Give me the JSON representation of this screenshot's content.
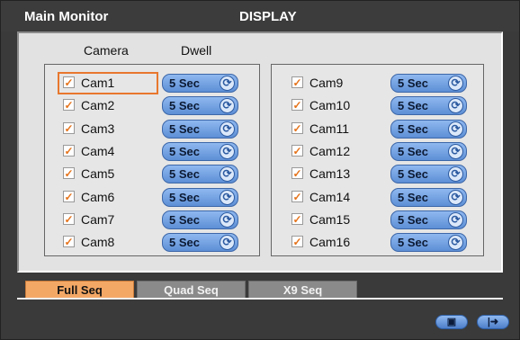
{
  "header": {
    "left_title": "Main Monitor",
    "center_title": "DISPLAY"
  },
  "columns": {
    "camera": "Camera",
    "dwell": "Dwell"
  },
  "left_group": [
    {
      "label": "Cam1",
      "dwell": "5 Sec",
      "checked": true
    },
    {
      "label": "Cam2",
      "dwell": "5 Sec",
      "checked": true
    },
    {
      "label": "Cam3",
      "dwell": "5 Sec",
      "checked": true
    },
    {
      "label": "Cam4",
      "dwell": "5 Sec",
      "checked": true
    },
    {
      "label": "Cam5",
      "dwell": "5 Sec",
      "checked": true
    },
    {
      "label": "Cam6",
      "dwell": "5 Sec",
      "checked": true
    },
    {
      "label": "Cam7",
      "dwell": "5 Sec",
      "checked": true
    },
    {
      "label": "Cam8",
      "dwell": "5 Sec",
      "checked": true
    }
  ],
  "right_group": [
    {
      "label": "Cam9",
      "dwell": "5 Sec",
      "checked": true
    },
    {
      "label": "Cam10",
      "dwell": "5 Sec",
      "checked": true
    },
    {
      "label": "Cam11",
      "dwell": "5 Sec",
      "checked": true
    },
    {
      "label": "Cam12",
      "dwell": "5 Sec",
      "checked": true
    },
    {
      "label": "Cam13",
      "dwell": "5 Sec",
      "checked": true
    },
    {
      "label": "Cam14",
      "dwell": "5 Sec",
      "checked": true
    },
    {
      "label": "Cam15",
      "dwell": "5 Sec",
      "checked": true
    },
    {
      "label": "Cam16",
      "dwell": "5 Sec",
      "checked": true
    }
  ],
  "tabs": [
    {
      "label": "Full Seq",
      "active": true
    },
    {
      "label": "Quad Seq",
      "active": false
    },
    {
      "label": "X9 Seq",
      "active": false
    }
  ],
  "icons": {
    "checkbox": "checkmark-icon",
    "cycle": "cycle-icon",
    "save": "save-icon",
    "exit": "exit-icon"
  },
  "colors": {
    "accent_orange": "#f4a866",
    "focus_orange": "#e8772e",
    "dwell_blue": "#5d8fd6"
  }
}
